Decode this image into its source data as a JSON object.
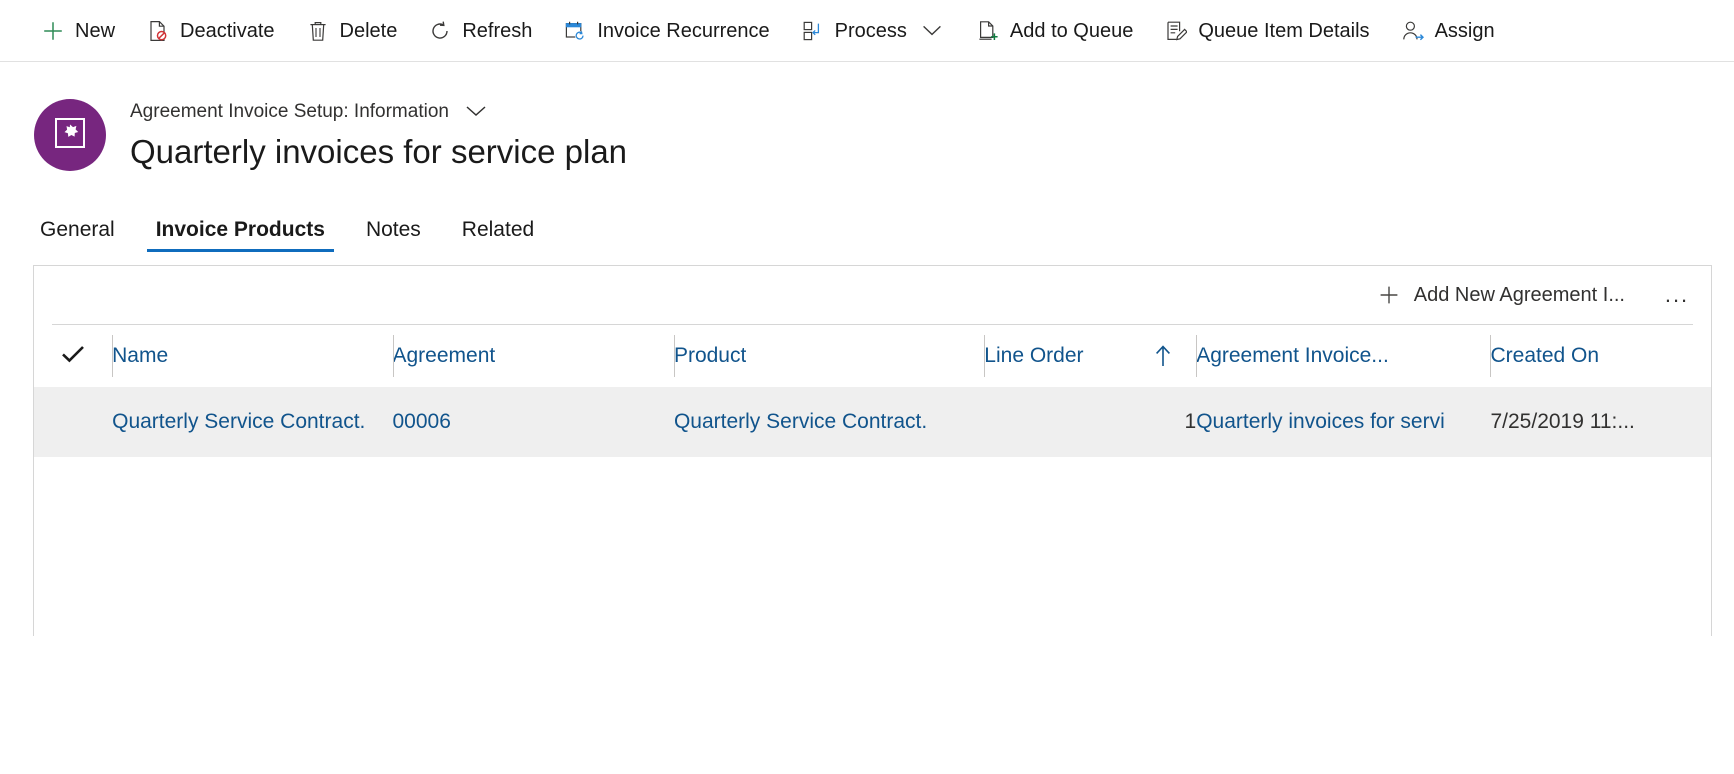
{
  "command_bar": {
    "items": [
      {
        "label": "New",
        "icon": "plus-icon"
      },
      {
        "label": "Deactivate",
        "icon": "deactivate-icon"
      },
      {
        "label": "Delete",
        "icon": "trash-icon"
      },
      {
        "label": "Refresh",
        "icon": "refresh-icon"
      },
      {
        "label": "Invoice Recurrence",
        "icon": "calendar-sync-icon"
      },
      {
        "label": "Process",
        "icon": "process-icon",
        "has_chevron": true
      },
      {
        "label": "Add to Queue",
        "icon": "add-to-queue-icon"
      },
      {
        "label": "Queue Item Details",
        "icon": "queue-item-details-icon"
      },
      {
        "label": "Assign",
        "icon": "assign-user-icon"
      }
    ]
  },
  "record_header": {
    "avatar_icon": "agreement-invoice-setup-icon",
    "subtitle": "Agreement Invoice Setup: Information",
    "subtitle_chevron_icon": "chevron-down-icon",
    "title": "Quarterly invoices for service plan"
  },
  "tabs": [
    {
      "label": "General",
      "active": false
    },
    {
      "label": "Invoice Products",
      "active": true
    },
    {
      "label": "Notes",
      "active": false
    },
    {
      "label": "Related",
      "active": false
    }
  ],
  "grid": {
    "toolbar": {
      "add_icon": "plus-icon",
      "add_label": "Add New Agreement I...",
      "overflow_icon": "ellipsis-icon",
      "overflow_label": "..."
    },
    "select_all_icon": "checkmark-icon",
    "columns": [
      {
        "label": "Name",
        "sort": null
      },
      {
        "label": "Agreement",
        "sort": null
      },
      {
        "label": "Product",
        "sort": null
      },
      {
        "label": "Line Order",
        "sort": "asc"
      },
      {
        "label": "Agreement Invoice...",
        "sort": null
      },
      {
        "label": "Created On",
        "sort": null
      }
    ],
    "sort_asc_icon": "arrow-up-icon",
    "rows": [
      {
        "name": "Quarterly Service Contract.",
        "agreement": "00006",
        "product": "Quarterly Service Contract.",
        "line_order": "1",
        "agreement_invoice": "Quarterly invoices for servi",
        "created_on": "7/25/2019 11:..."
      }
    ]
  },
  "colors": {
    "accent_blue": "#0f6cbd",
    "link_blue": "#11548c",
    "avatar_purple": "#77267f",
    "row_selected_gray": "#efefef",
    "new_icon_green": "#107c41",
    "border_gray": "#d6d6d6"
  }
}
